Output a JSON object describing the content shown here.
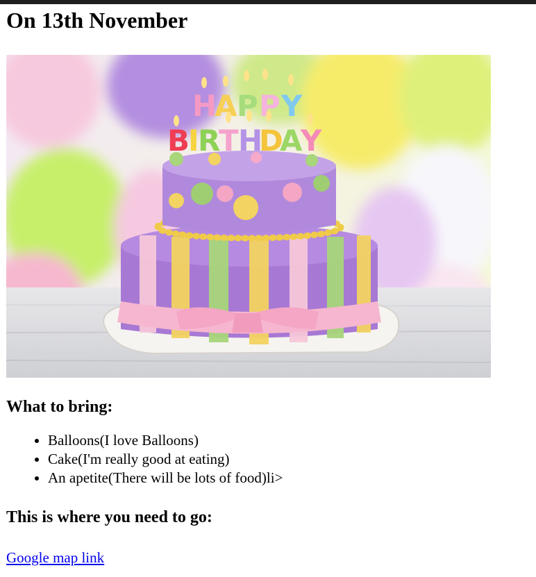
{
  "page": {
    "title": "On 13th November",
    "image": {
      "subject": "birthday-cake-photo",
      "cake_text": "HAPPY BIRTHDAY"
    },
    "bring_heading": "What to bring:",
    "bring_items": [
      "Balloons(I love Balloons)",
      "Cake(I'm really good at eating)",
      "An apetite(There will be lots of food)li>"
    ],
    "go_heading": "This is where you need to go:",
    "map_link": "Google map link"
  },
  "colors": {
    "link": "#0000ee",
    "topbar": "#1f1f1f"
  }
}
